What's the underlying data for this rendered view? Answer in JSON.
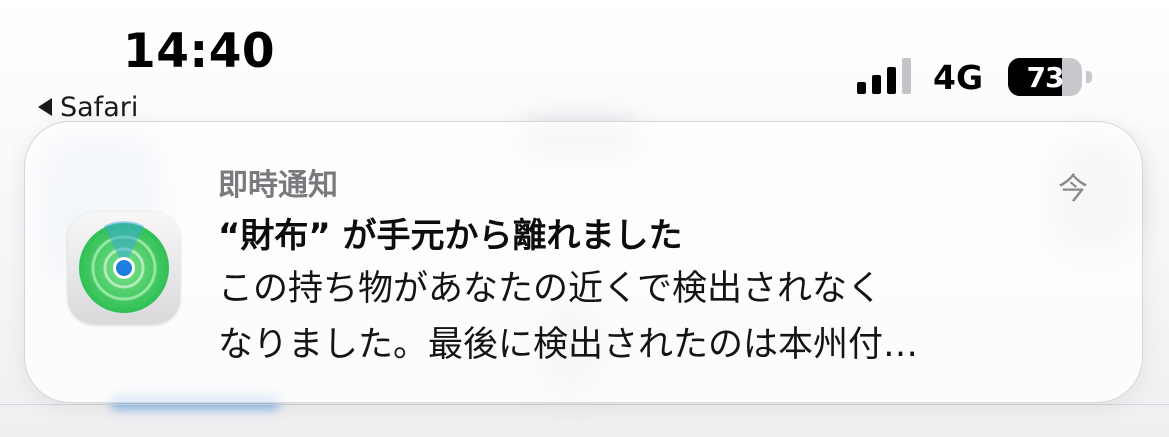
{
  "status_bar": {
    "time": "14:40",
    "back_app": "Safari",
    "network": "4G",
    "battery_percent": "73",
    "battery_level": 0.73,
    "signal_bars_active": 3,
    "signal_bars_total": 4
  },
  "notification": {
    "app_name": "即時通知",
    "time": "今",
    "title": "“財布” が手元から離れました",
    "body_line1": "この持ち物があなたの近くで検出されなく",
    "body_line2": "なりました。最後に検出されたのは本州付…",
    "app_icon": "find-my-icon",
    "accent_color": "#34c759"
  }
}
